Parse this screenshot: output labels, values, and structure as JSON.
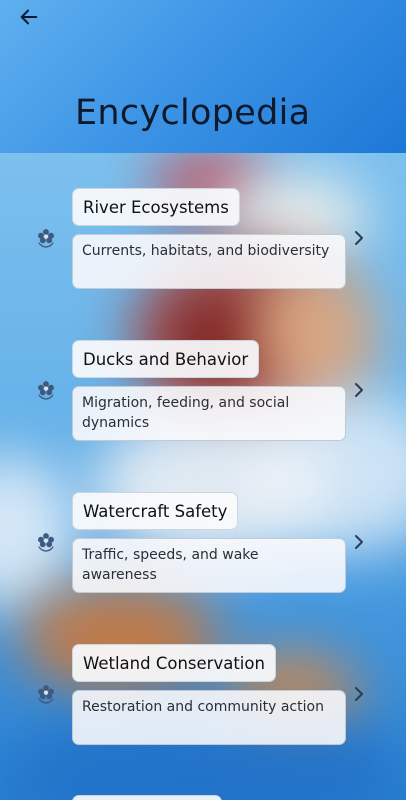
{
  "header": {
    "title": "Encyclopedia",
    "back_icon": "arrow-left-icon",
    "gradient": [
      "#5fb0ef",
      "#1d78d6"
    ]
  },
  "entries": [
    {
      "title": "River Ecosystems",
      "description": "Currents, habitats, and biodiversity",
      "icon": "flower-icon"
    },
    {
      "title": "Ducks and Behavior",
      "description": "Migration, feeding, and social dynamics",
      "icon": "flower-icon"
    },
    {
      "title": "Watercraft Safety",
      "description": "Traffic, speeds, and wake awareness",
      "icon": "flower-icon"
    },
    {
      "title": "Wetland Conservation",
      "description": "Restoration and community action",
      "icon": "flower-icon"
    }
  ],
  "colors": {
    "icon": "#3d5a80",
    "chevron": "#2b3c52"
  }
}
